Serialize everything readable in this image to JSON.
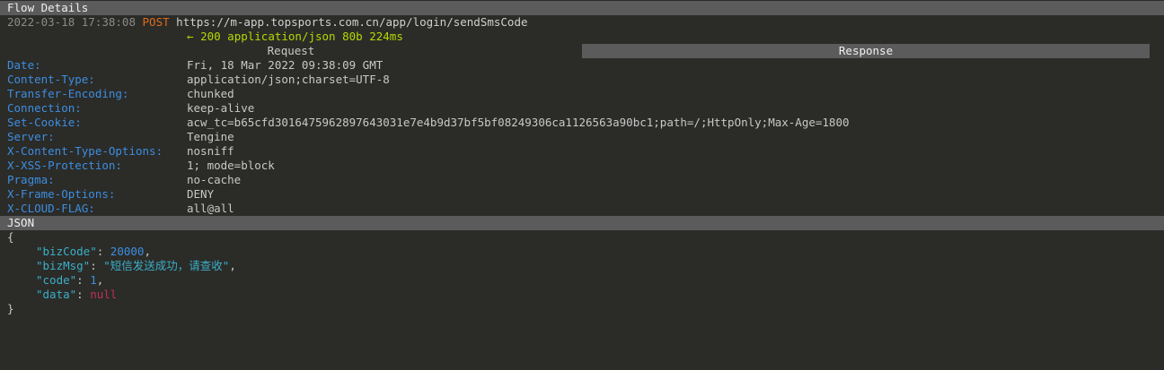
{
  "window": {
    "title": "Flow Details"
  },
  "flow": {
    "timestamp": "2022-03-18 17:38:08",
    "method": "POST",
    "url": "https://m-app.topsports.com.cn/app/login/sendSmsCode",
    "arrow": "←",
    "status": "200",
    "content_type": "application/json",
    "size": "80b",
    "duration": "224ms"
  },
  "tabs": {
    "request": "Request",
    "response": "Response",
    "active": "Response"
  },
  "headers": [
    {
      "key": "Date:",
      "value": "Fri, 18 Mar 2022 09:38:09 GMT"
    },
    {
      "key": "Content-Type:",
      "value": "application/json;charset=UTF-8"
    },
    {
      "key": "Transfer-Encoding:",
      "value": "chunked"
    },
    {
      "key": "Connection:",
      "value": "keep-alive"
    },
    {
      "key": "Set-Cookie:",
      "value": "acw_tc=b65cfd3016475962897643031e7e4b9d37bf5bf08249306ca1126563a90bc1;path=/;HttpOnly;Max-Age=1800"
    },
    {
      "key": "Server:",
      "value": "Tengine"
    },
    {
      "key": "X-Content-Type-Options:",
      "value": "nosniff"
    },
    {
      "key": "X-XSS-Protection:",
      "value": "1; mode=block"
    },
    {
      "key": "Pragma:",
      "value": "no-cache"
    },
    {
      "key": "X-Frame-Options:",
      "value": "DENY"
    },
    {
      "key": "X-CLOUD-FLAG:",
      "value": "all@all"
    }
  ],
  "body": {
    "view_mode": "JSON",
    "open_brace": "{",
    "close_brace": "}",
    "fields": [
      {
        "key": "\"bizCode\"",
        "value": "20000",
        "comma": ","
      },
      {
        "key": "\"bizMsg\"",
        "value": "\"短信发送成功，请查收\"",
        "comma": ","
      },
      {
        "key": "\"code\"",
        "value": "1",
        "comma": ","
      },
      {
        "key": "\"data\"",
        "value": "null",
        "comma": ""
      }
    ]
  },
  "colors": {
    "background": "#2b2b28",
    "bar": "#5b5b5b",
    "header_key": "#3d8ee0",
    "method": "#e06c1b",
    "status": "#b6d800",
    "json_string": "#3ab0c8",
    "json_null": "#c0305a"
  }
}
